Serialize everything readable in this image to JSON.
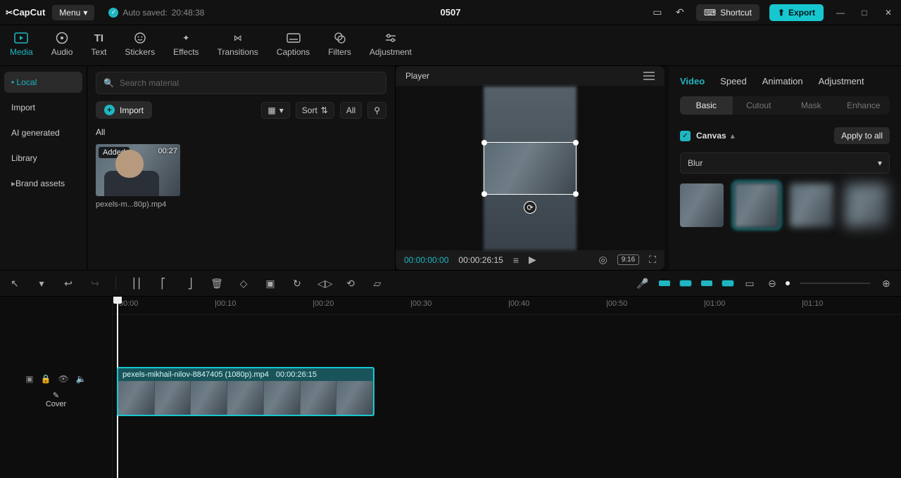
{
  "app": {
    "name": "CapCut",
    "menu": "Menu",
    "autosaved_prefix": "Auto saved:",
    "autosaved_time": "20:48:38",
    "project_title": "0507"
  },
  "titlebar": {
    "shortcut": "Shortcut",
    "export": "Export"
  },
  "topTabs": [
    {
      "id": "media",
      "label": "Media",
      "active": true
    },
    {
      "id": "audio",
      "label": "Audio"
    },
    {
      "id": "text",
      "label": "Text"
    },
    {
      "id": "stickers",
      "label": "Stickers"
    },
    {
      "id": "effects",
      "label": "Effects"
    },
    {
      "id": "transitions",
      "label": "Transitions"
    },
    {
      "id": "captions",
      "label": "Captions"
    },
    {
      "id": "filters",
      "label": "Filters"
    },
    {
      "id": "adjustment",
      "label": "Adjustment"
    }
  ],
  "sidebar": {
    "items": [
      {
        "id": "local",
        "label": "Local",
        "active": true,
        "bullet": true
      },
      {
        "id": "import",
        "label": "Import"
      },
      {
        "id": "ai",
        "label": "AI generated"
      },
      {
        "id": "library",
        "label": "Library"
      },
      {
        "id": "brand",
        "label": "Brand assets",
        "arrow": true
      }
    ]
  },
  "mediaPanel": {
    "search_placeholder": "Search material",
    "import_btn": "Import",
    "sort": "Sort",
    "all": "All",
    "section": "All",
    "clip": {
      "added": "Added",
      "duration": "00:27",
      "filename": "pexels-m...80p).mp4"
    }
  },
  "player": {
    "title": "Player",
    "current": "00:00:00:00",
    "total": "00:00:26:15",
    "ratio": "9:16"
  },
  "rightPanel": {
    "tabs": [
      {
        "id": "video",
        "label": "Video",
        "active": true
      },
      {
        "id": "speed",
        "label": "Speed"
      },
      {
        "id": "animation",
        "label": "Animation"
      },
      {
        "id": "adjustment",
        "label": "Adjustment"
      }
    ],
    "subtabs": [
      {
        "id": "basic",
        "label": "Basic",
        "active": true
      },
      {
        "id": "cutout",
        "label": "Cutout"
      },
      {
        "id": "mask",
        "label": "Mask"
      },
      {
        "id": "enhance",
        "label": "Enhance"
      }
    ],
    "canvas_label": "Canvas",
    "apply_all": "Apply to all",
    "blur_select": "Blur"
  },
  "timeline": {
    "cover": "Cover",
    "clip_name": "pexels-mikhail-nilov-8847405 (1080p).mp4",
    "clip_dur": "00:00:26:15",
    "ticks": [
      "|00:00",
      "|00:10",
      "|00:20",
      "|00:30",
      "|00:40",
      "|00:50",
      "|01:00",
      "|01:10"
    ]
  }
}
